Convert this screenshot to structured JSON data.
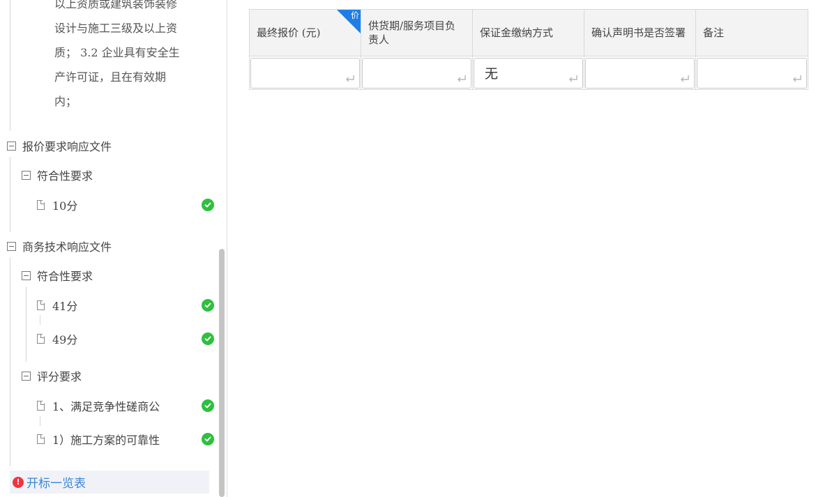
{
  "sidebar": {
    "description_lines": [
      "以上资质或建筑装饰装修",
      "设计与施工三级及以上资",
      "质； 3.2 企业具有安全生",
      "产许可证，且在有效期",
      "内；"
    ],
    "quote_section": {
      "label": "报价要求响应文件",
      "group": {
        "label": "符合性要求",
        "items": [
          {
            "label": "10分",
            "status": "done"
          }
        ]
      }
    },
    "business_section": {
      "label": "商务技术响应文件",
      "compliance_group": {
        "label": "符合性要求",
        "items": [
          {
            "label": "41分",
            "status": "done"
          },
          {
            "label": "49分",
            "status": "done"
          }
        ]
      },
      "scoring_group": {
        "label": "评分要求",
        "items": [
          {
            "label": "1、满足竞争性磋商公",
            "status": "done"
          },
          {
            "label": "1）施工方案的可靠性",
            "status": "done"
          }
        ]
      }
    },
    "bid_opening": {
      "label": "开标一览表",
      "warning_glyph": "!"
    }
  },
  "table": {
    "headers": [
      "最终报价 (元)",
      "供货期/服务项目负责人",
      "保证金缴纳方式",
      "确认声明书是否签署",
      "备注"
    ],
    "price_tag": "价",
    "row": [
      "",
      "",
      "无",
      "",
      ""
    ]
  },
  "colors": {
    "accent": "#1f7ee6",
    "success": "#2fbf3f",
    "warning": "#f0343f",
    "link": "#3a86d8"
  },
  "icons": [
    "collapse-icon",
    "document-icon",
    "check-circle-icon",
    "warning-icon",
    "enter-key-icon"
  ]
}
